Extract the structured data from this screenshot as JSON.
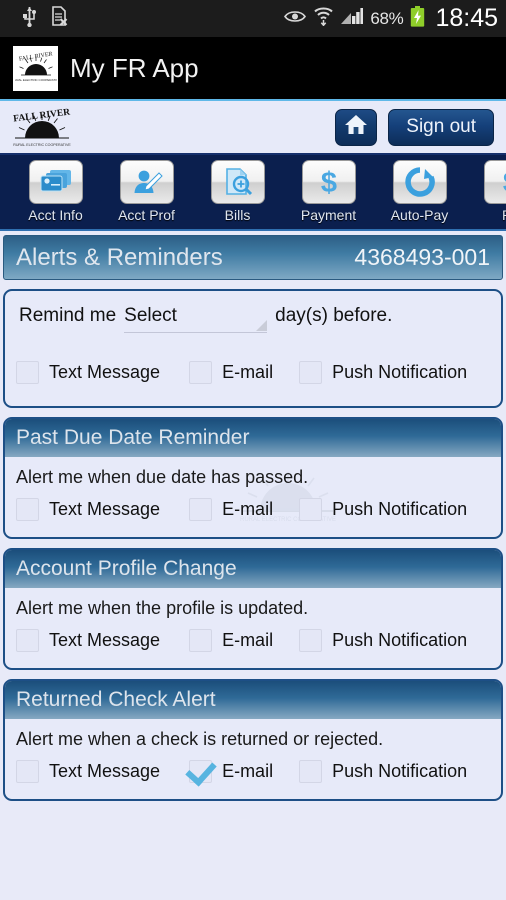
{
  "statusbar": {
    "icons": [
      "usb-icon",
      "sd-card-removed-icon",
      "eye-icon",
      "wifi-icon",
      "signal-bars-icon"
    ],
    "battery_percent": "68%",
    "clock": "18:45"
  },
  "appbar": {
    "logo_name": "fall-river-logo",
    "title": "My FR App"
  },
  "brandbar": {
    "logo_top_text": "FALL RIVER",
    "logo_bottom_text": "RURAL ELECTRIC COOPERATIVE",
    "home_label": "Home",
    "signout_label": "Sign out"
  },
  "nav": {
    "items": [
      {
        "label": "Acct Info",
        "icon": "cards-icon"
      },
      {
        "label": "Acct Prof",
        "icon": "user-edit-icon"
      },
      {
        "label": "Bills",
        "icon": "document-search-icon"
      },
      {
        "label": "Payment",
        "icon": "dollar-icon"
      },
      {
        "label": "Auto-Pay",
        "icon": "refresh-circle-icon"
      },
      {
        "label": "Pa",
        "icon": "dollar-icon"
      }
    ]
  },
  "page": {
    "title": "Alerts & Reminders",
    "account_number": "4368493-001"
  },
  "channels": {
    "text": "Text Message",
    "email": "E-mail",
    "push": "Push Notification"
  },
  "cards": [
    {
      "header": "",
      "remind_prefix": "Remind me",
      "spinner_value": "Select",
      "remind_suffix": "day(s) before.",
      "checked": {
        "text": false,
        "email": false,
        "push": false
      }
    },
    {
      "header": "Past Due Date Reminder",
      "description": "Alert me when due date has passed.",
      "checked": {
        "text": false,
        "email": false,
        "push": false
      }
    },
    {
      "header": "Account Profile Change",
      "description": "Alert me when the profile is updated.",
      "checked": {
        "text": false,
        "email": false,
        "push": false
      }
    },
    {
      "header": "Returned Check Alert",
      "description": "Alert me when a check is returned or rejected.",
      "checked": {
        "text": false,
        "email": true,
        "push": false
      }
    }
  ],
  "colors": {
    "app_bg": "#e7eaf9",
    "nav_bg": "#0b1f4e",
    "accent_blue": "#1d4f86",
    "check_blue": "#57b4e0"
  }
}
